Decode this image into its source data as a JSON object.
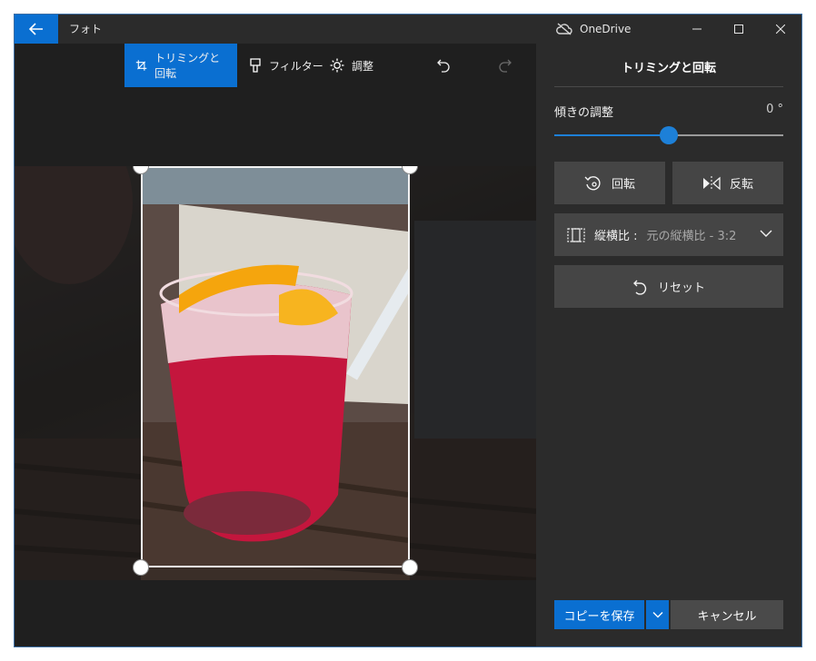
{
  "window": {
    "app_title": "フォト",
    "onedrive_label": "OneDrive"
  },
  "toolbar": {
    "tabs": [
      {
        "label": "トリミングと回転",
        "icon": "crop-rotate-icon",
        "active": true
      },
      {
        "label": "フィルター",
        "icon": "filter-icon",
        "active": false
      },
      {
        "label": "調整",
        "icon": "brightness-icon",
        "active": false
      }
    ],
    "undo_icon": "undo-icon",
    "redo_icon": "redo-icon"
  },
  "panel": {
    "title": "トリミングと回転",
    "straighten": {
      "label": "傾きの調整",
      "value": "0 °",
      "level": 0.5
    },
    "rotate_label": "回転",
    "flip_label": "反転",
    "aspect": {
      "label": "縦横比 :",
      "value": "元の縦横比 - 3:2"
    },
    "reset_label": "リセット",
    "save_copy_label": "コピーを保存",
    "cancel_label": "キャンセル"
  },
  "colors": {
    "accent": "#0a6fd1",
    "panel_bg": "#2b2b2b",
    "canvas_bg": "#1f1f1f",
    "button_bg": "#454545"
  }
}
